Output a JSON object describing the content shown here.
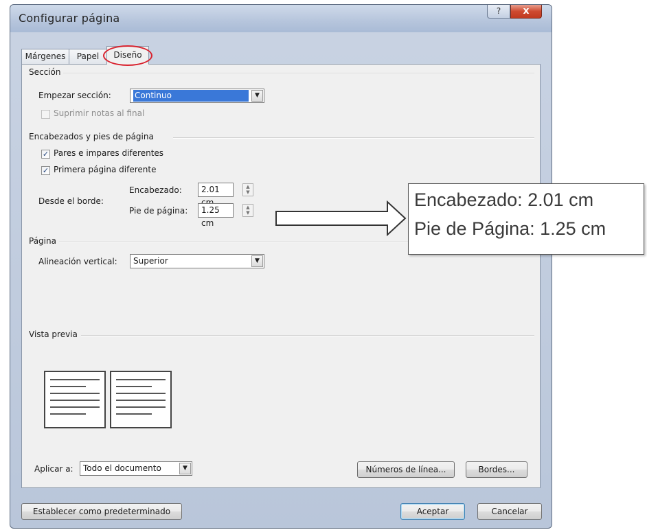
{
  "window": {
    "title": "Configurar página",
    "help_label": "?",
    "close_label": "x"
  },
  "tabs": [
    {
      "label": "Márgenes",
      "active": false
    },
    {
      "label": "Papel",
      "active": false
    },
    {
      "label": "Diseño",
      "active": true
    }
  ],
  "section": {
    "heading": "Sección",
    "start_label": "Empezar sección:",
    "start_value": "Continuo",
    "suppress_endnotes_label": "Suprimir notas al final",
    "suppress_endnotes_checked": false,
    "suppress_endnotes_enabled": false
  },
  "headers_footers": {
    "heading": "Encabezados y pies de página",
    "odd_even_label": "Pares e impares diferentes",
    "odd_even_checked": true,
    "first_page_label": "Primera página diferente",
    "first_page_checked": true,
    "from_edge_label": "Desde el borde:",
    "header_label": "Encabezado:",
    "header_value": "2.01 cm",
    "footer_label": "Pie de página:",
    "footer_value": "1.25 cm"
  },
  "page": {
    "heading": "Página",
    "vertical_align_label": "Alineación vertical:",
    "vertical_align_value": "Superior"
  },
  "preview": {
    "heading": "Vista previa"
  },
  "apply": {
    "label": "Aplicar a:",
    "value": "Todo el documento"
  },
  "buttons": {
    "line_numbers": "Números de línea...",
    "borders": "Bordes...",
    "set_default": "Establecer como predeterminado",
    "ok": "Aceptar",
    "cancel": "Cancelar"
  },
  "callout": {
    "line1": "Encabezado: 2.01 cm",
    "line2": "Pie de Página: 1.25 cm"
  },
  "colors": {
    "highlight_ellipse": "#d9232f",
    "selection": "#3a78d8",
    "close_button": "#c03a20"
  }
}
